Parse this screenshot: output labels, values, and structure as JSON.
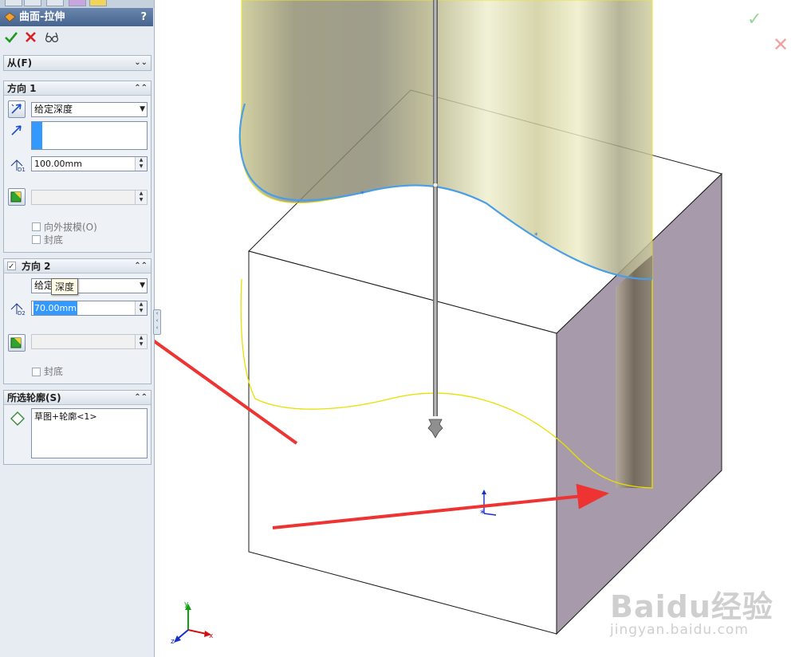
{
  "title": "曲面-拉伸",
  "help_label": "?",
  "from_section": {
    "label": "从(F)"
  },
  "direction1": {
    "label": "方向 1",
    "end_condition": "给定深度",
    "depth": "100.00mm",
    "d_label": "D1",
    "draft_label": "向外拔模(O)",
    "cap_label": "封底"
  },
  "direction2": {
    "label": "方向 2",
    "end_condition": "给定",
    "tooltip": "深度",
    "depth": "70.00mm",
    "d_label": "D2",
    "cap_label": "封底"
  },
  "contours": {
    "label": "所选轮廓(S)",
    "items": [
      "草图+轮廓<1>"
    ]
  },
  "axes": {
    "x": "x",
    "y": "y",
    "z": "z"
  },
  "watermark": {
    "brand": "Baidu经验",
    "url": "jingyan.baidu.com"
  },
  "icons": {
    "ok": "check-icon",
    "cancel": "cross-icon",
    "preview": "glasses-icon",
    "reverse": "reverse-direction-icon",
    "direction": "direction-arrow-icon",
    "draft": "draft-icon",
    "contour": "contour-diamond-icon"
  },
  "colors": {
    "panel_bg": "#e7ecf3",
    "title_bar": "#45648f",
    "selection": "#3399ff",
    "cube_face": "#a79aaa",
    "surface": "#c9c892",
    "profile_curve": "#4a9ee8",
    "annotation_arrow": "#ee3333"
  }
}
